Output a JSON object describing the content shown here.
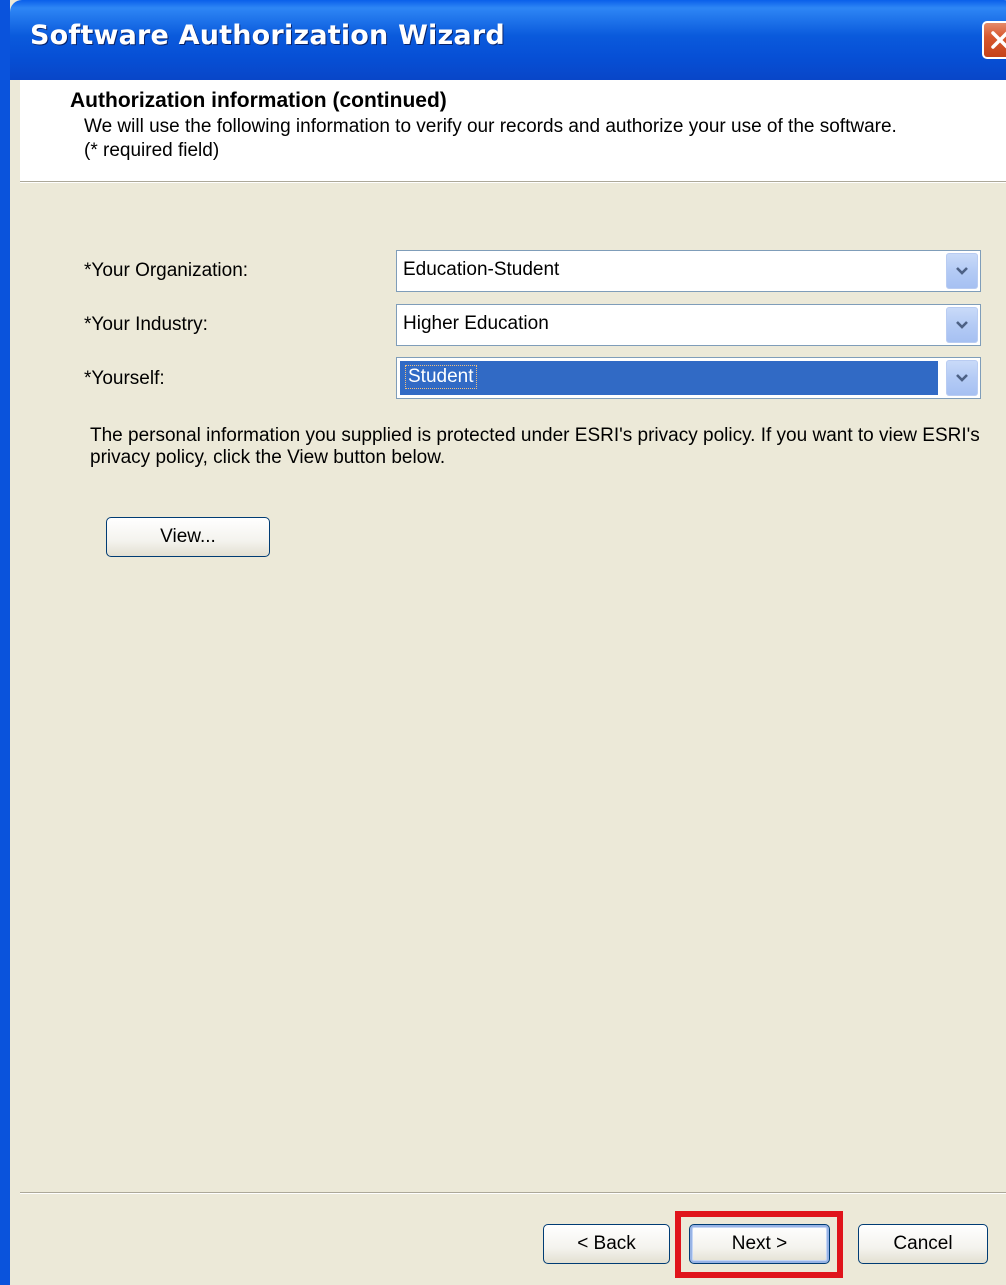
{
  "window": {
    "title": "Software Authorization Wizard"
  },
  "header": {
    "title": "Authorization information (continued)",
    "description": "We will use the following information to verify our records and authorize your use of the software. (* required field)"
  },
  "form": {
    "fields": [
      {
        "label": "*Your Organization:",
        "value": "Education-Student",
        "selected": false
      },
      {
        "label": "*Your Industry:",
        "value": "Higher Education",
        "selected": false
      },
      {
        "label": "*Yourself:",
        "value": "Student",
        "selected": true
      }
    ]
  },
  "privacy": {
    "text": "The personal information you supplied is protected under ESRI's privacy policy. If you want to view ESRI's privacy policy, click the View button below.",
    "view_button": "View..."
  },
  "footer": {
    "back_label": "< Back",
    "next_label": "Next >",
    "cancel_label": "Cancel"
  },
  "icons": {
    "close": "close-icon",
    "dropdown": "chevron-down-icon"
  },
  "colors": {
    "titlebar": "#0A5ADC",
    "selection": "#316AC5",
    "highlight_box": "#E0141B",
    "dialog_bg": "#ECE9D8"
  }
}
